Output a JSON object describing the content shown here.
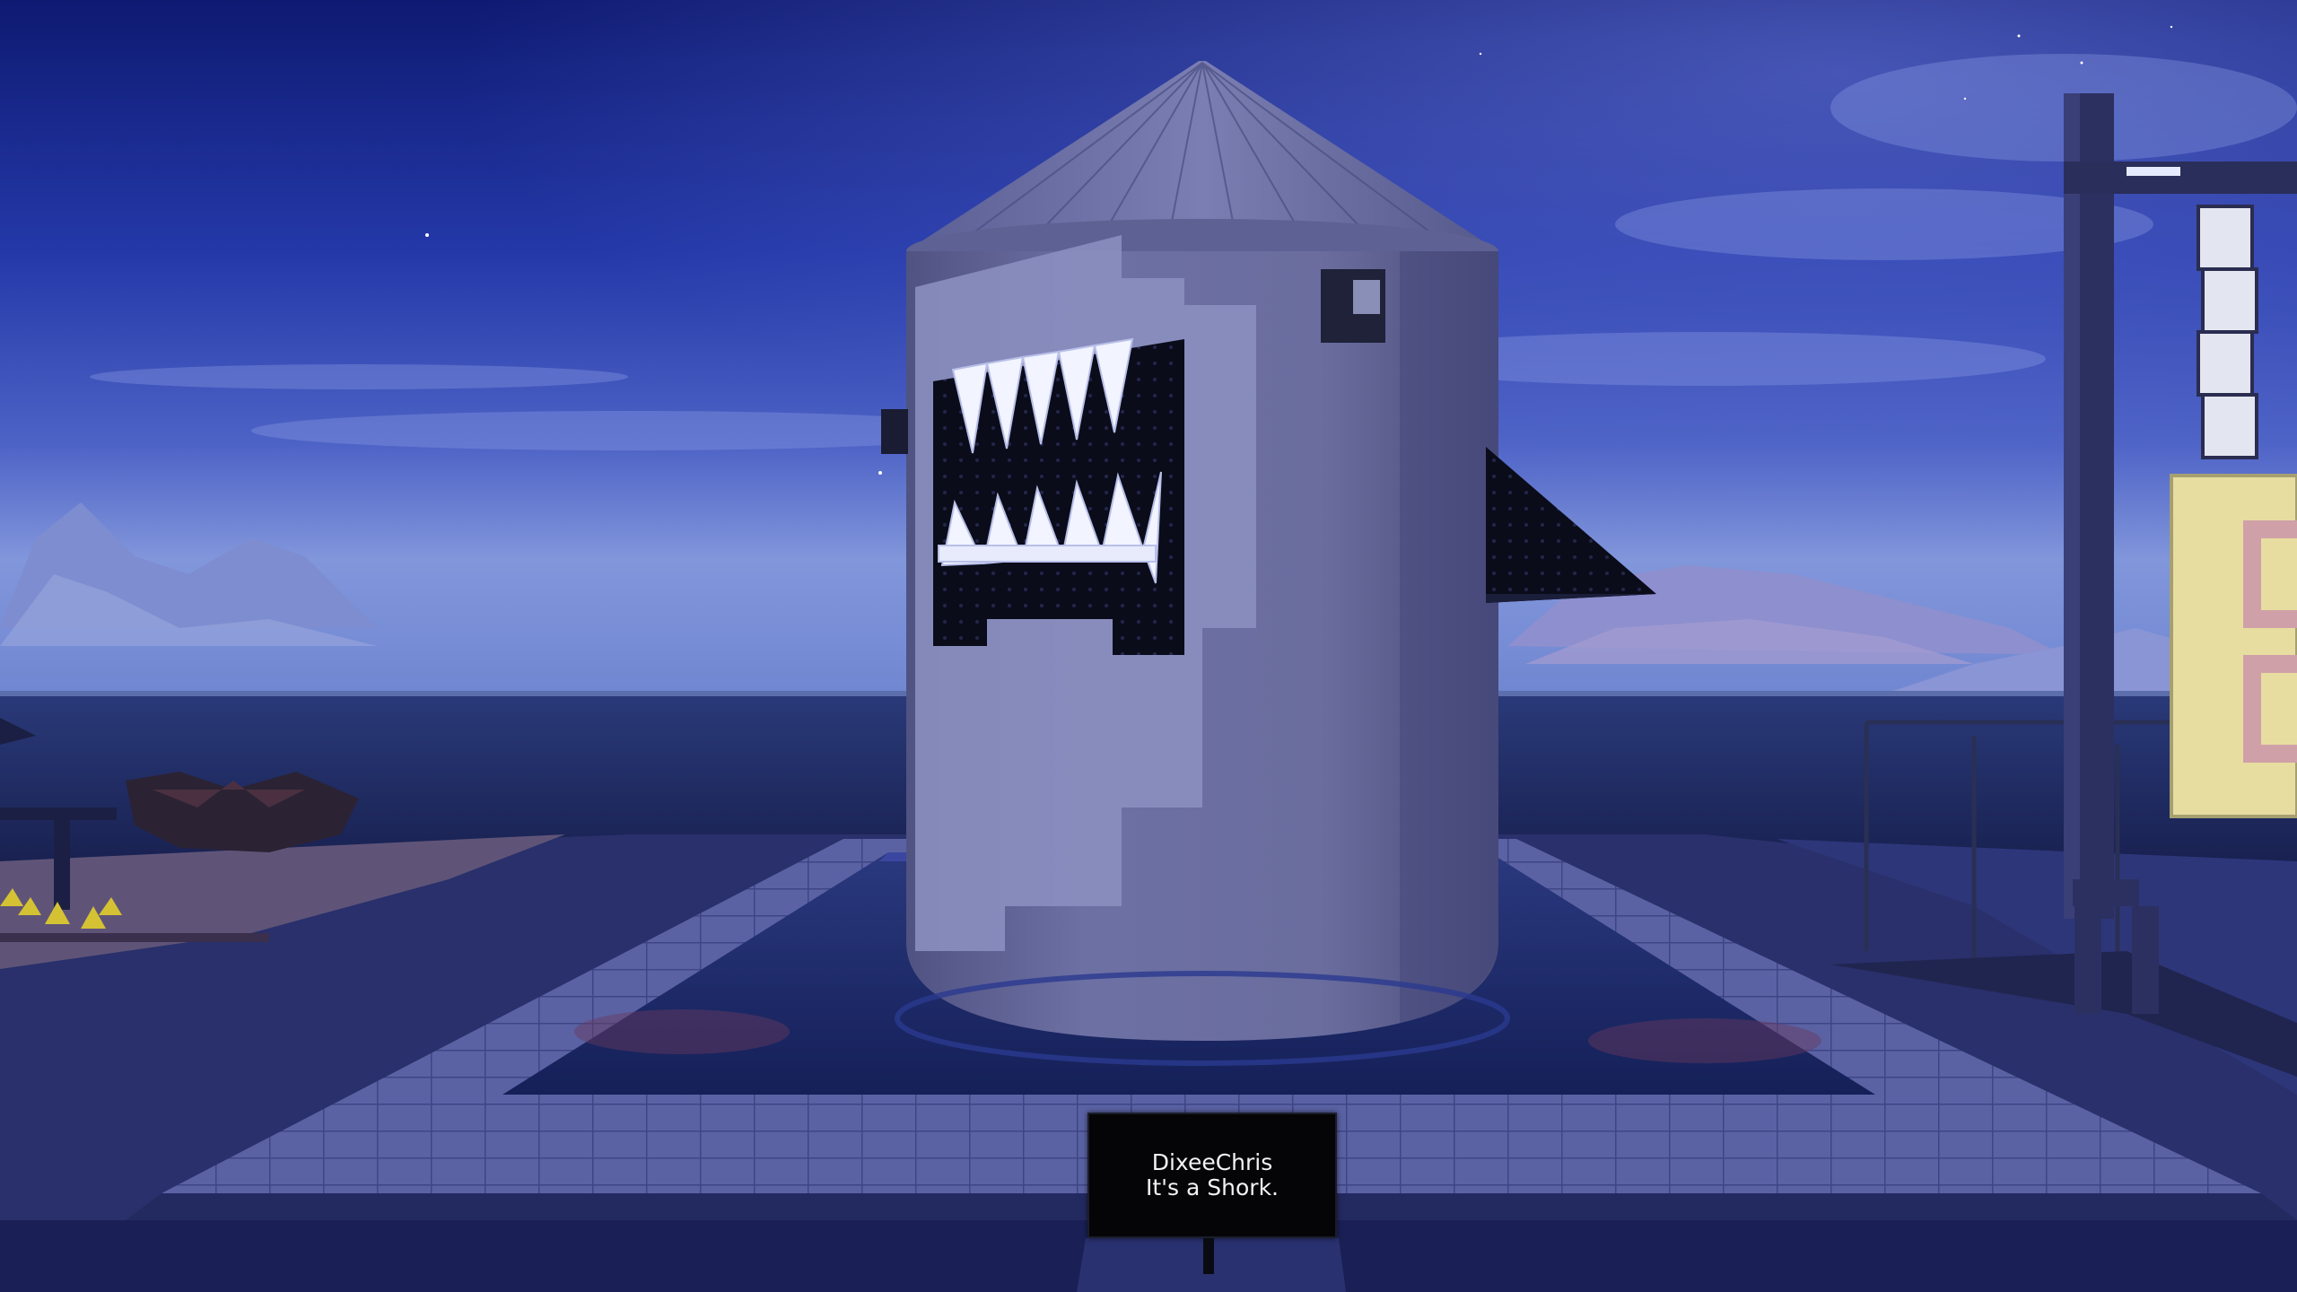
{
  "scene": {
    "description_name": "shark silo build",
    "colors": {
      "sky_top": "#0e1a72",
      "sky_mid": "#2f44b8",
      "sky_horizon": "#7a8fd6",
      "ocean": "#1d2a63",
      "ground": "#2c3470",
      "tile": "#5e66a8",
      "silo_body": "#6b6fa0",
      "silo_patch": "#8d92c2",
      "mouth": "#0b0d1c",
      "teeth": "#f4f6ff",
      "water": "#1f2c6e"
    }
  },
  "sign": {
    "line1": "DixeeChris",
    "line2": "It's a Shork."
  },
  "icons": {
    "silo": "shark-silo-icon",
    "fin": "dorsal-fin-icon",
    "streetlight": "streetlight-icon"
  }
}
